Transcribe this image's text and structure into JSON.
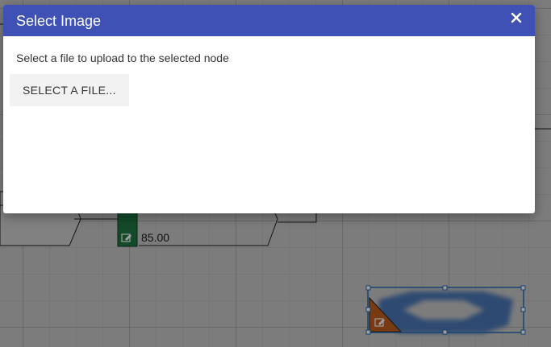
{
  "dialog": {
    "title": "Select Image",
    "close_label": "×",
    "message": "Select a file to upload to the selected node",
    "select_button_label": "SELECT A FILE..."
  },
  "canvas": {
    "node_value": "85.00",
    "node_colors": {
      "green_bar": "#1f7a45",
      "triangle": "#c25e1f",
      "selection": "#2b6cb0"
    }
  },
  "icons": {
    "edit": "edit-icon",
    "close": "close-icon"
  }
}
